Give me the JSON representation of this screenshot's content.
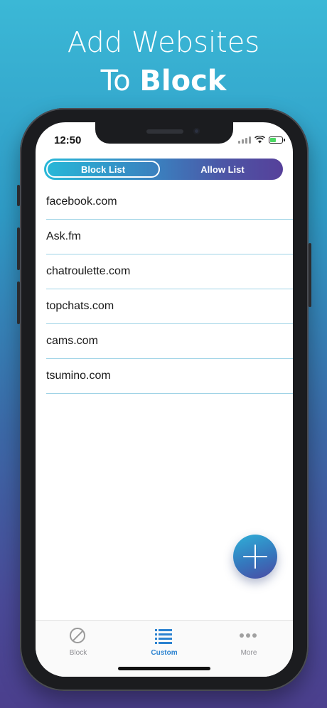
{
  "headline": {
    "line1": "Add Websites",
    "line2_prefix": "To",
    "line2_bold": "Block"
  },
  "status_bar": {
    "time": "12:50",
    "icons": [
      "signal-icon",
      "wifi-icon",
      "battery-charging-icon"
    ]
  },
  "segmented_control": {
    "active": "Block List",
    "inactive": "Allow List"
  },
  "block_list": [
    "facebook.com",
    "Ask.fm",
    "chatroulette.com",
    "topchats.com",
    "cams.com",
    "tsumino.com"
  ],
  "fab": {
    "icon": "plus-icon"
  },
  "tab_bar": {
    "tabs": [
      {
        "label": "Block",
        "icon": "block-icon"
      },
      {
        "label": "Custom",
        "icon": "list-icon",
        "selected": true
      },
      {
        "label": "More",
        "icon": "more-icon"
      }
    ]
  },
  "colors": {
    "accent": "#2b82d0",
    "row_divider": "#9fd3e6",
    "gradient_start": "#27b8d8",
    "gradient_end": "#56409a"
  }
}
